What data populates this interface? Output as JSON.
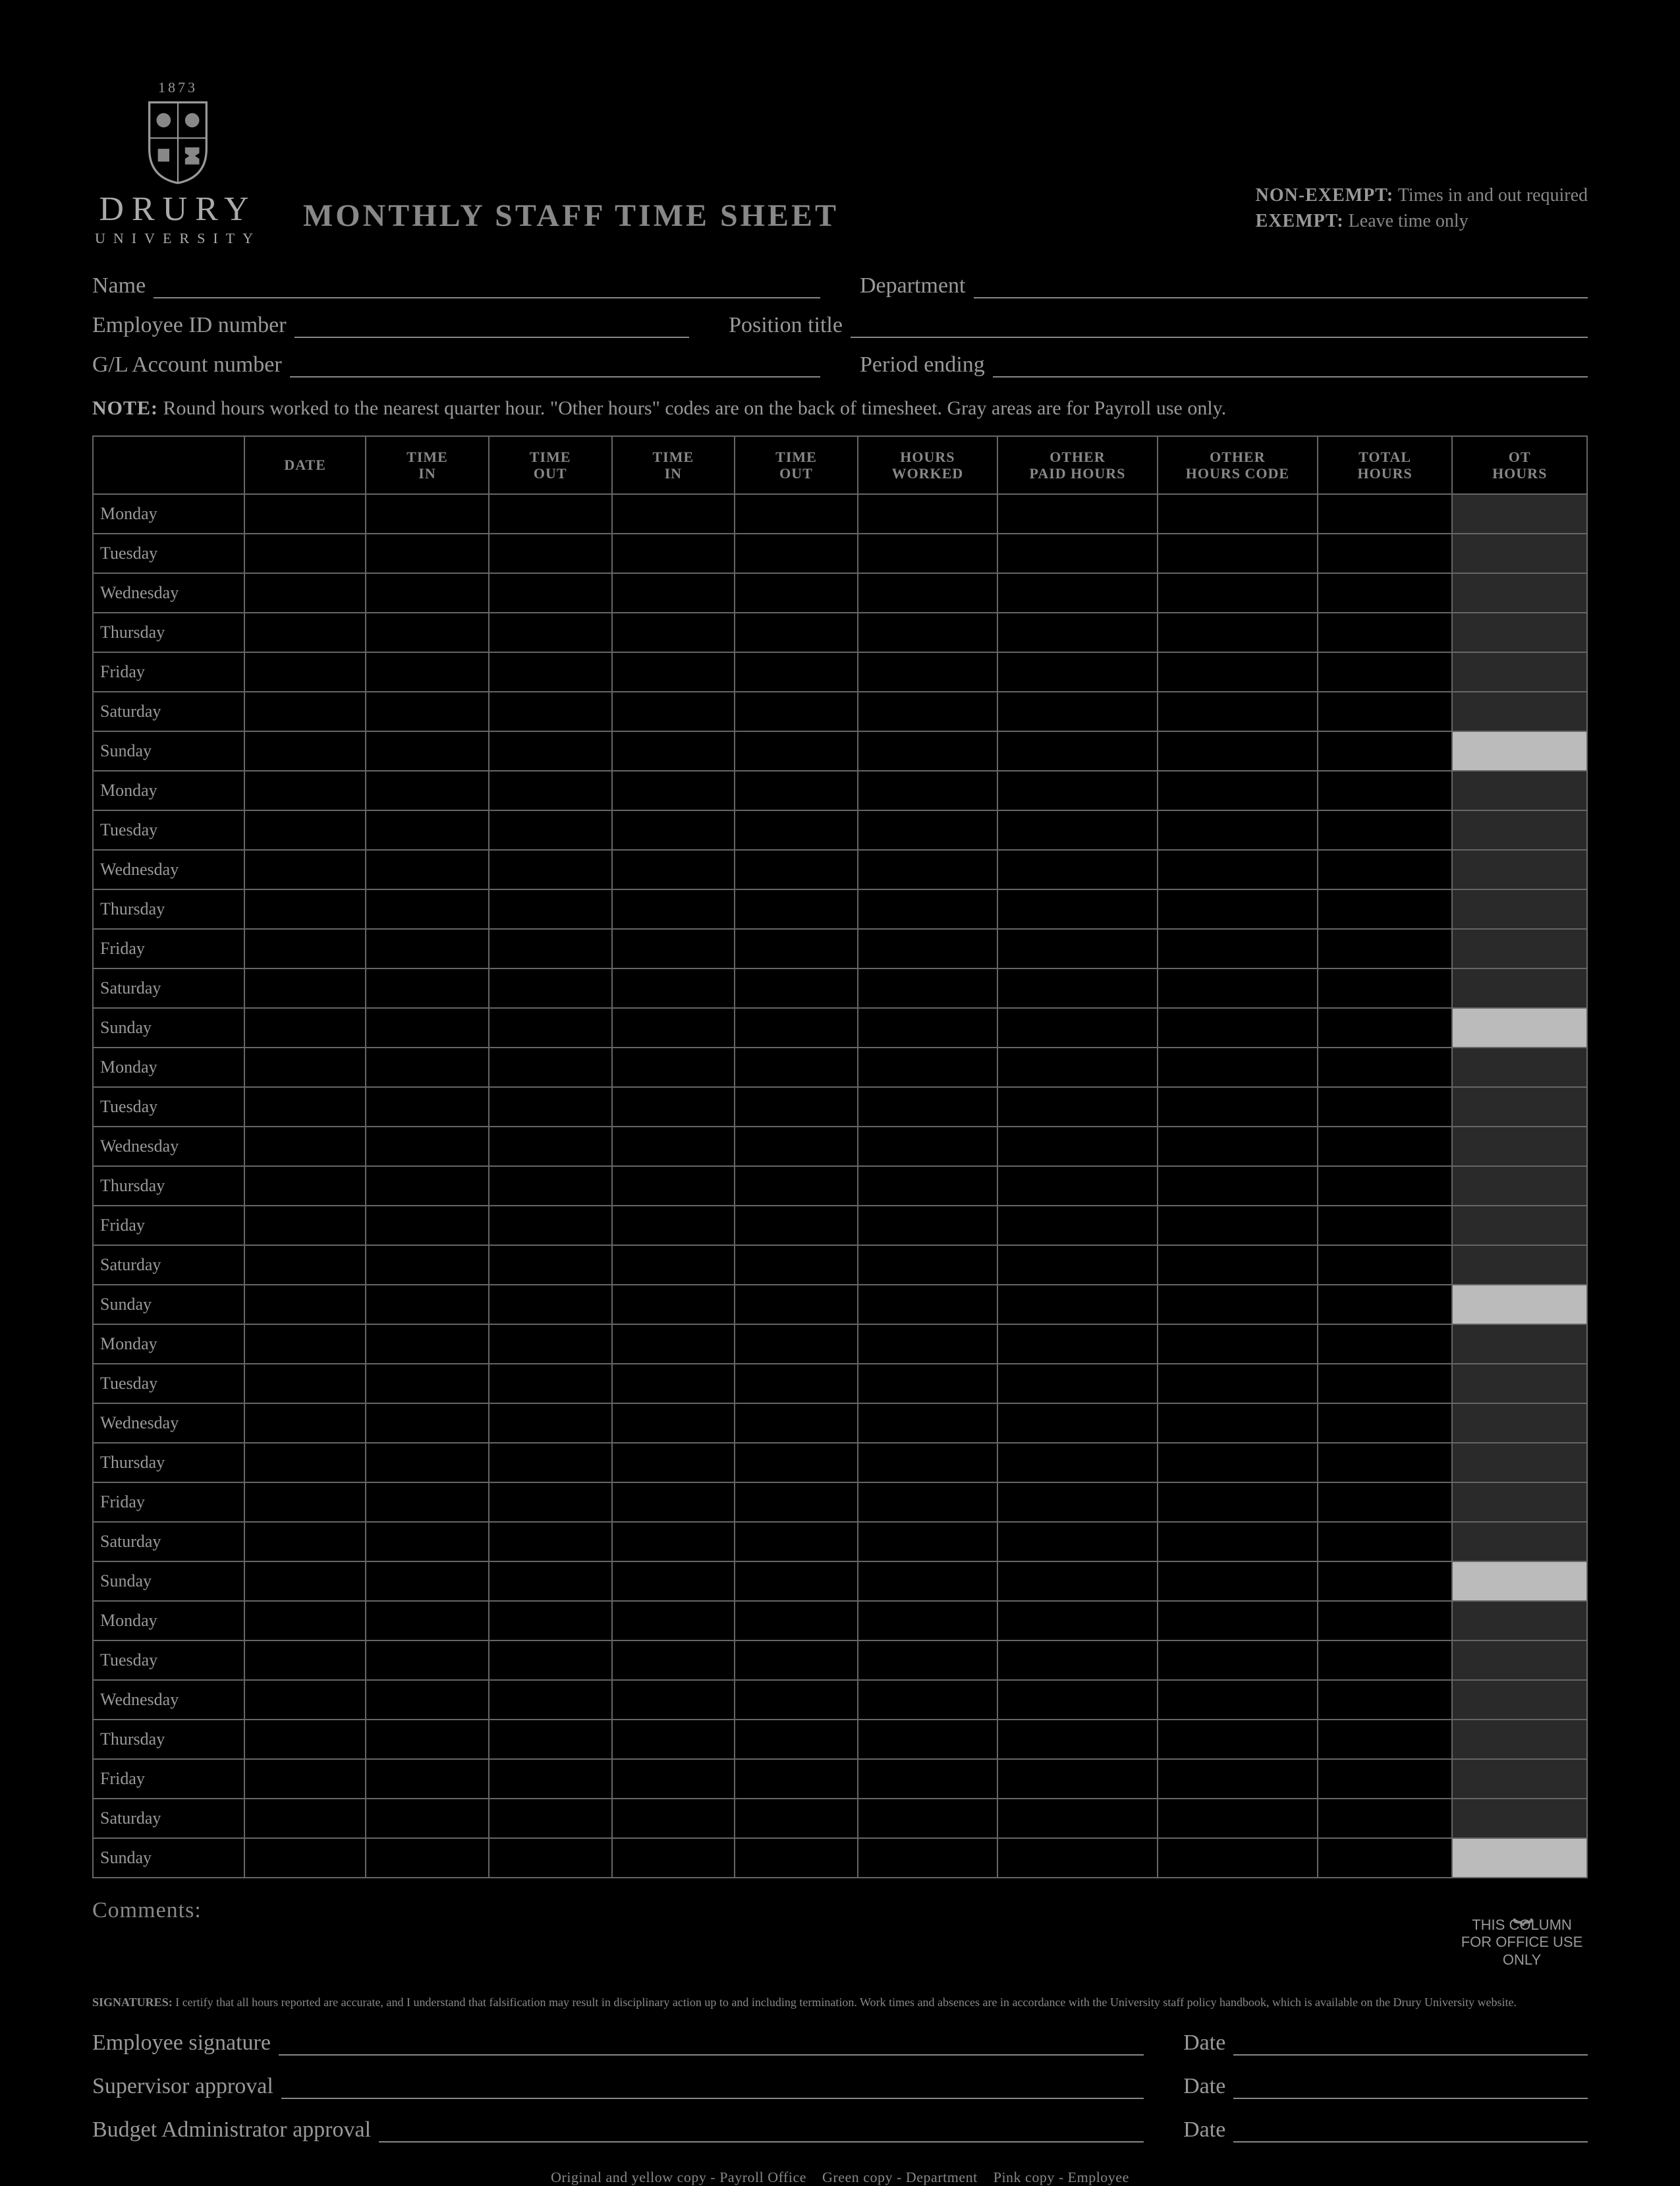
{
  "logo": {
    "year": "1873",
    "name": "DRURY",
    "sub": "UNIVERSITY"
  },
  "title": "MONTHLY STAFF TIME SHEET",
  "legend": {
    "non_exempt_label": "NON-EXEMPT:",
    "non_exempt_text": "Times in and out required",
    "exempt_label": "EXEMPT:",
    "exempt_text": "Leave time only"
  },
  "fields": {
    "name": "Name",
    "department": "Department",
    "employee_id": "Employee ID number",
    "position_title": "Position title",
    "gl_account": "G/L Account number",
    "period_ending": "Period ending"
  },
  "note_label": "NOTE:",
  "note_text": "Round hours worked to the nearest quarter hour. \"Other hours\" codes are on the back of timesheet. Gray areas are for Payroll use only.",
  "columns": [
    "",
    "DATE",
    "TIME IN",
    "TIME OUT",
    "TIME IN",
    "TIME OUT",
    "HOURS WORKED",
    "OTHER PAID HOURS",
    "OTHER HOURS CODE",
    "TOTAL HOURS",
    "OT HOURS"
  ],
  "days": [
    "Monday",
    "Tuesday",
    "Wednesday",
    "Thursday",
    "Friday",
    "Saturday",
    "Sunday"
  ],
  "weeks": 5,
  "comments": "Comments:",
  "office_use": "THIS COLUMN FOR OFFICE USE ONLY",
  "sig_note_label": "SIGNATURES:",
  "sig_note_text": "I certify that all hours reported are accurate, and I understand that falsification may result in disciplinary action up to and including termination. Work times and absences are in accordance with the University staff policy handbook, which is available on the Drury University website.",
  "signatures": {
    "employee": "Employee signature",
    "supervisor": "Supervisor approval",
    "budget": "Budget Administrator approval",
    "date": "Date"
  },
  "footer": "Original and yellow copy - Payroll Office    Green copy - Department    Pink copy - Employee"
}
